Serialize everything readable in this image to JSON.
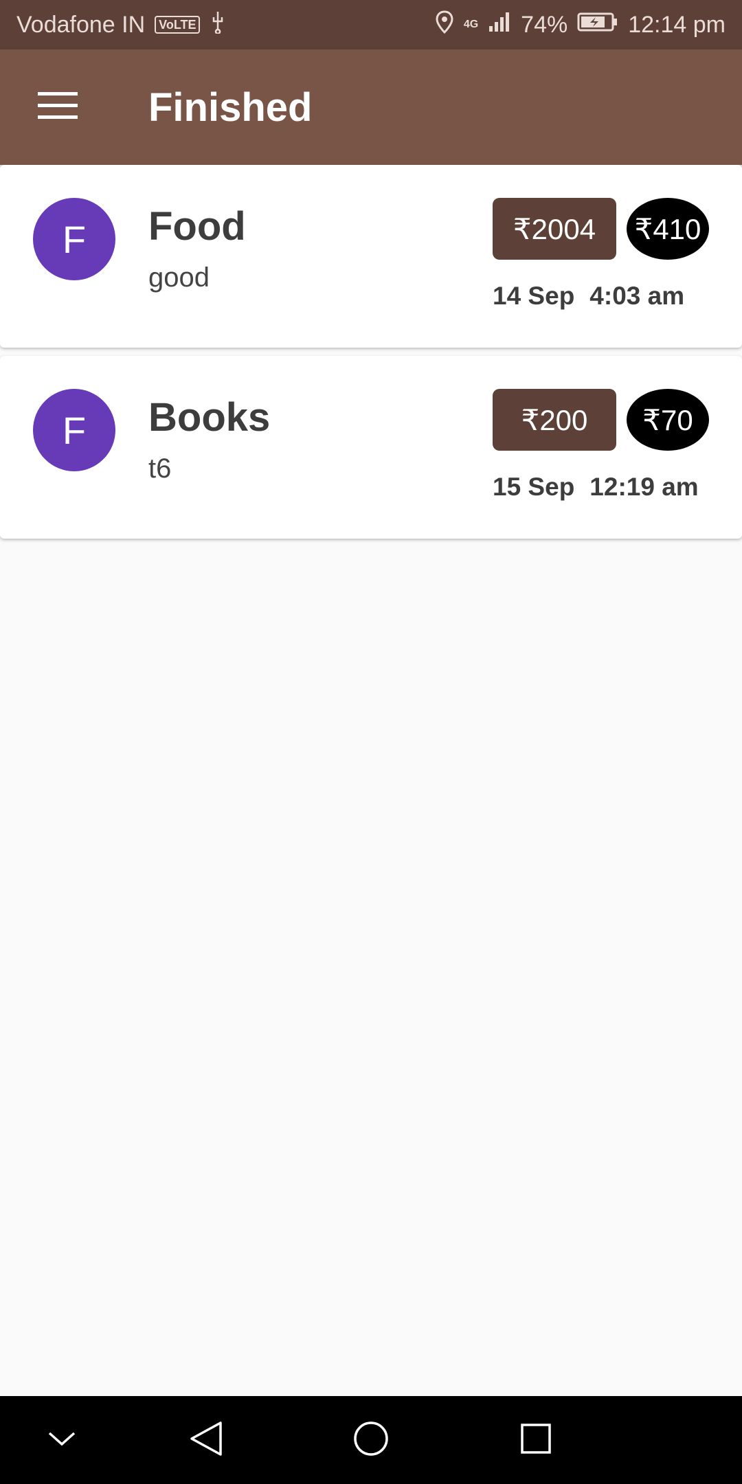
{
  "status_bar": {
    "carrier": "Vodafone IN",
    "volte": "VoLTE",
    "network": "4G",
    "battery": "74%",
    "time": "12:14 pm"
  },
  "app_bar": {
    "title": "Finished"
  },
  "items": [
    {
      "avatar": "F",
      "name": "Food",
      "note": "good",
      "amount": "₹2004",
      "secondary": "₹410",
      "date": "14 Sep",
      "time": "4:03 am"
    },
    {
      "avatar": "F",
      "name": "Books",
      "note": "t6",
      "amount": "₹200",
      "secondary": "₹70",
      "date": "15 Sep",
      "time": "12:19 am"
    }
  ],
  "colors": {
    "status_bar": "#5d4037",
    "app_bar": "#795548",
    "avatar": "#673ab7",
    "amount_badge": "#5d4037",
    "secondary_badge": "#000000"
  },
  "icons": {
    "menu": "hamburger-menu-icon",
    "nav": [
      "chevron-down-icon",
      "back-triangle-icon",
      "home-circle-icon",
      "recents-square-icon"
    ]
  }
}
